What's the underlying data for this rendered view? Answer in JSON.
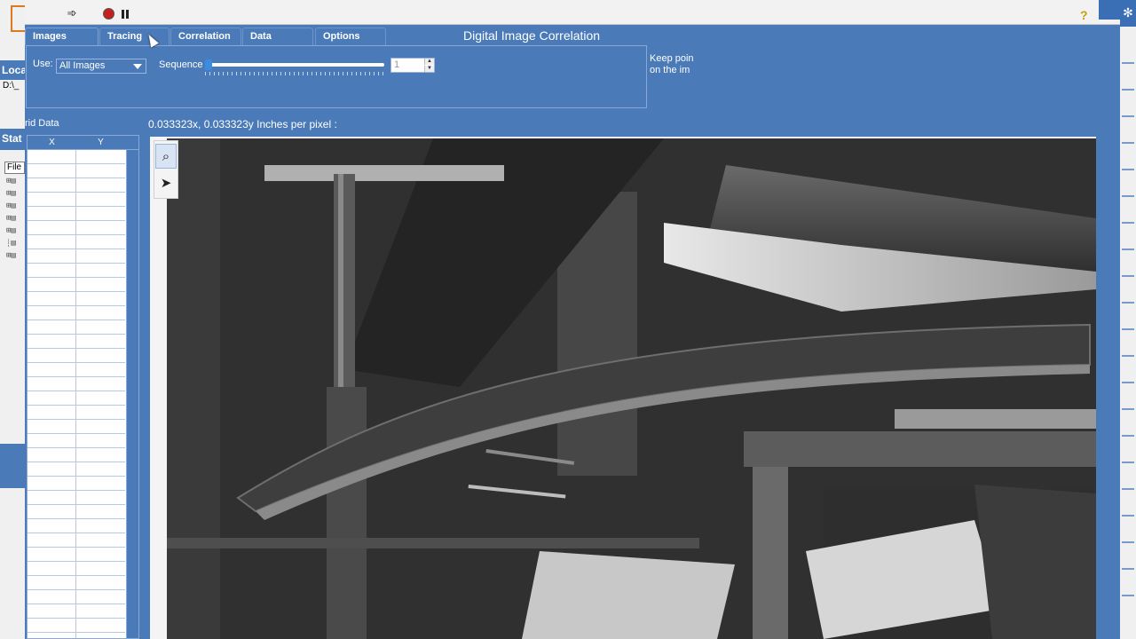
{
  "background_left": {
    "labels": [
      "Loca",
      "Stat"
    ],
    "path": "D:\\_",
    "file_button": "File",
    "tree_rows": [
      "⊞▤",
      "⊞▤",
      "⊞▤",
      "⊞▤",
      "⊞▤",
      "⊞▤",
      "┊▤",
      "⊞▤"
    ]
  },
  "toolbar": {
    "forward_icon": "➾",
    "record_icon": "record-icon",
    "pause_icon": "pause-icon",
    "help_label": "?"
  },
  "tabs": [
    {
      "label": "Images",
      "active": true
    },
    {
      "label": "Tracing",
      "active": false
    },
    {
      "label": "Correlation",
      "active": false
    },
    {
      "label": "Data",
      "active": false
    },
    {
      "label": "Options",
      "active": false
    }
  ],
  "title": "Digital Image Correlation",
  "images_panel": {
    "use_label": "Use:",
    "use_value": "All Images",
    "sequence_label": "Sequence",
    "sequence_value": "1",
    "slider_fraction": 0.0
  },
  "hint": "Keep poin on the im",
  "grid": {
    "label": "rid Data",
    "columns": [
      "X",
      "Y"
    ]
  },
  "scale": {
    "text": "0.033323x,  0.033323y  Inches per pixel  :"
  },
  "viewer_tools": {
    "zoom_icon": "⌕",
    "pointer_icon": "➤"
  },
  "colors": {
    "panel_blue": "#4a7ab8",
    "record_red": "#c42020",
    "slider_blue": "#3a8de0"
  }
}
